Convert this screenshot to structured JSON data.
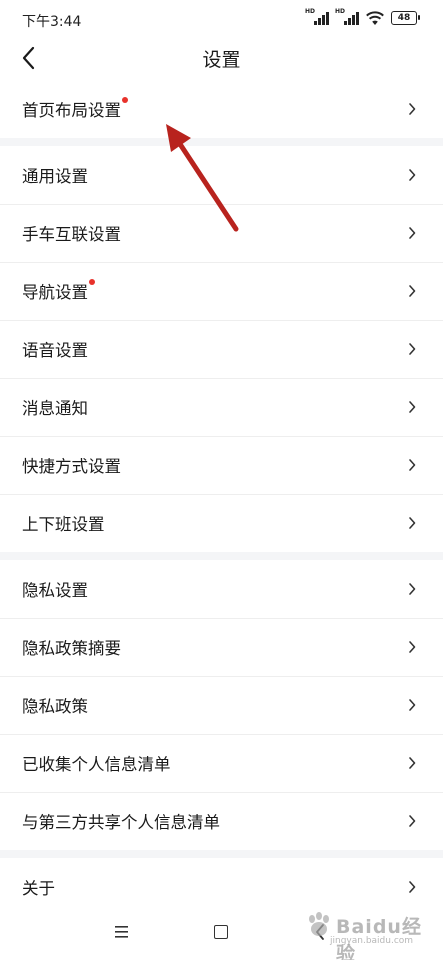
{
  "status_bar": {
    "time": "下午3:44",
    "signal1_label": "HD",
    "signal2_label": "HD",
    "battery": "48"
  },
  "header": {
    "title": "设置"
  },
  "groups": [
    [
      {
        "label": "首页布局设置",
        "badge": true
      }
    ],
    [
      {
        "label": "通用设置",
        "badge": false
      },
      {
        "label": "手车互联设置",
        "badge": false
      },
      {
        "label": "导航设置",
        "badge": true
      },
      {
        "label": "语音设置",
        "badge": false
      },
      {
        "label": "消息通知",
        "badge": false
      },
      {
        "label": "快捷方式设置",
        "badge": false
      },
      {
        "label": "上下班设置",
        "badge": false
      }
    ],
    [
      {
        "label": "隐私设置",
        "badge": false
      },
      {
        "label": "隐私政策摘要",
        "badge": false
      },
      {
        "label": "隐私政策",
        "badge": false
      },
      {
        "label": "已收集个人信息清单",
        "badge": false
      },
      {
        "label": "与第三方共享个人信息清单",
        "badge": false
      }
    ],
    [
      {
        "label": "关于",
        "badge": false
      }
    ]
  ],
  "watermark": {
    "text": "Baidu经验",
    "url": "jingyan.baidu.com"
  },
  "colors": {
    "badge": "#e8322b",
    "annotation_arrow": "#b8231e",
    "divider": "#eeeeee",
    "group_gap": "#f4f5f7"
  }
}
